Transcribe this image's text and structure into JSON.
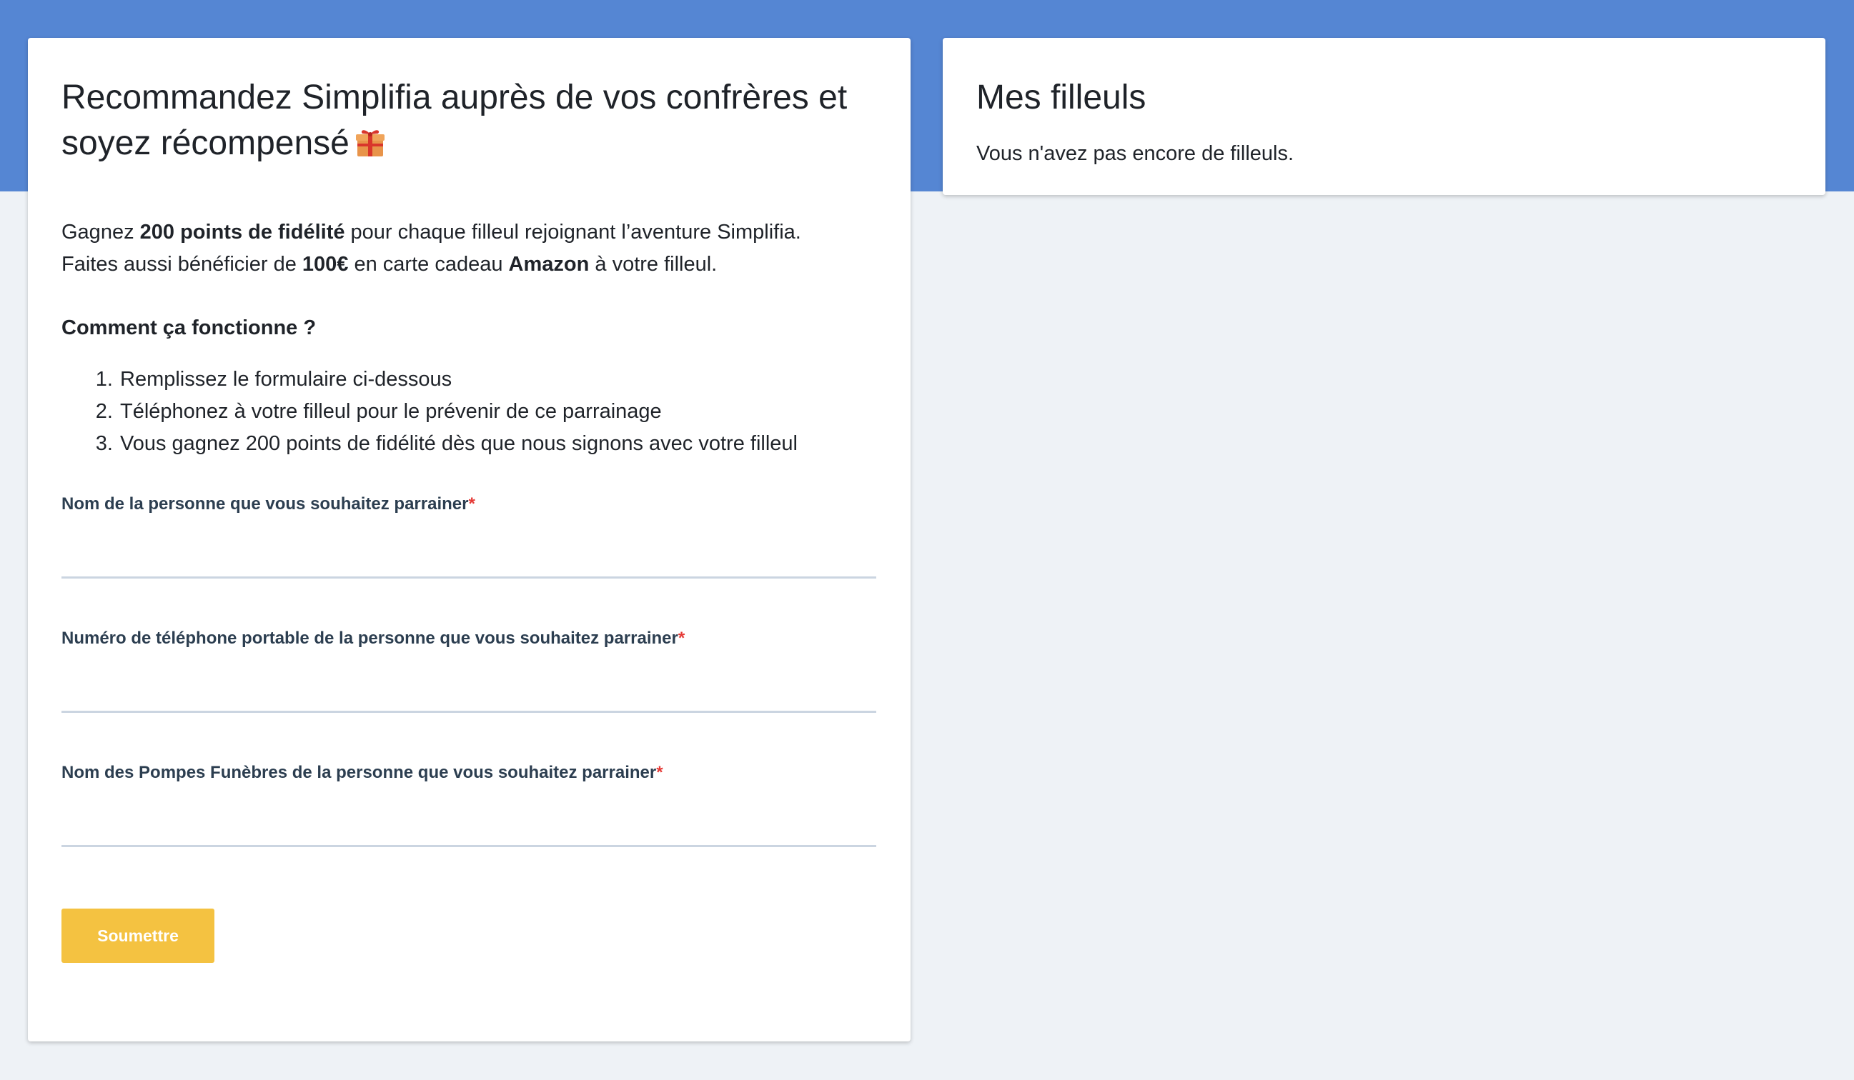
{
  "referral_form": {
    "title_line1": "Recommandez Simplifia auprès de vos confrères et",
    "title_line2": "soyez récompensé",
    "title_icon": "gift-icon",
    "intro": {
      "line1_prefix": "Gagnez ",
      "line1_bold": "200 points de fidélité",
      "line1_suffix": " pour chaque filleul rejoignant l’aventure Simplifia.",
      "line2_prefix": "Faites aussi bénéficier de ",
      "line2_bold_amount": "100€",
      "line2_middle": " en carte cadeau ",
      "line2_bold_brand": "Amazon",
      "line2_suffix": " à votre filleul."
    },
    "how_title": "Comment ça fonctionne ?",
    "steps": [
      "Remplissez le formulaire ci-dessous",
      "Téléphonez à votre filleul pour le prévenir de ce parrainage",
      "Vous gagnez 200 points de fidélité dès que nous signons avec votre filleul"
    ],
    "fields": [
      {
        "label": "Nom de la personne que vous souhaitez parrainer",
        "required_mark": "*",
        "value": "",
        "placeholder": ""
      },
      {
        "label": "Numéro de téléphone portable de la personne que vous souhaitez parrainer",
        "required_mark": "*",
        "value": "",
        "placeholder": ""
      },
      {
        "label": "Nom des Pompes Funèbres de la personne que vous souhaitez parrainer",
        "required_mark": "*",
        "value": "",
        "placeholder": ""
      }
    ],
    "submit_label": "Soumettre"
  },
  "referrals_panel": {
    "title": "Mes filleuls",
    "empty_message": "Vous n'avez pas encore de filleuls."
  },
  "colors": {
    "header_band": "#5586d3",
    "page_background": "#eef2f6",
    "submit_button": "#f4c241",
    "required_mark": "#e53935",
    "field_label": "#2c3e50",
    "input_underline": "#cbd5e1"
  }
}
